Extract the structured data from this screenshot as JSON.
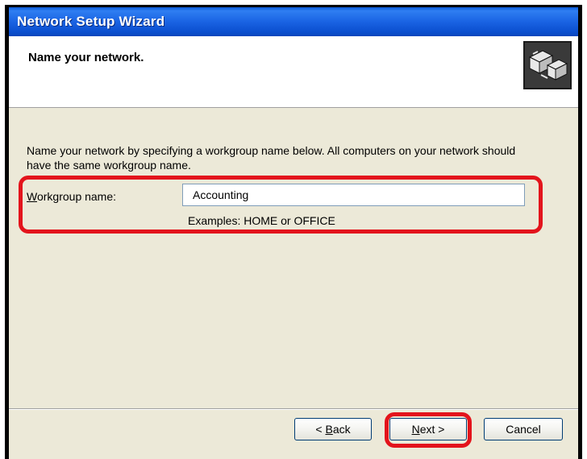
{
  "window": {
    "title": "Network Setup Wizard"
  },
  "header": {
    "heading": "Name your network.",
    "icon": "network-computers-icon"
  },
  "content": {
    "description": "Name your network by specifying a workgroup name below. All computers on your network should have the same workgroup name.",
    "workgroup": {
      "label_mnemonic": "W",
      "label_rest": "orkgroup name:",
      "value": "Accounting",
      "hint": "Examples: HOME or OFFICE"
    }
  },
  "buttons": {
    "back": {
      "prefix": "< ",
      "mnemonic": "B",
      "rest": "ack"
    },
    "next": {
      "mnemonic": "N",
      "rest": "ext >"
    },
    "cancel": "Cancel"
  },
  "colors": {
    "titlebar": "#0a5ad8",
    "dialog": "#ece9d8",
    "highlight": "#e3141c"
  }
}
